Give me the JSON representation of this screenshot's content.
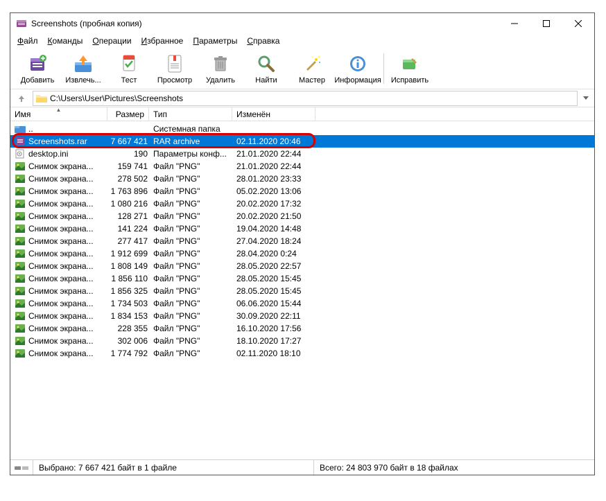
{
  "title": "Screenshots (пробная копия)",
  "menu": [
    "Файл",
    "Команды",
    "Операции",
    "Избранное",
    "Параметры",
    "Справка"
  ],
  "tools": [
    {
      "id": "add",
      "label": "Добавить"
    },
    {
      "id": "extract",
      "label": "Извлечь..."
    },
    {
      "id": "test",
      "label": "Тест"
    },
    {
      "id": "view",
      "label": "Просмотр"
    },
    {
      "id": "delete",
      "label": "Удалить"
    },
    {
      "id": "find",
      "label": "Найти"
    },
    {
      "id": "wizard",
      "label": "Мастер"
    },
    {
      "id": "info",
      "label": "Информация"
    },
    {
      "id": "sep"
    },
    {
      "id": "repair",
      "label": "Исправить"
    }
  ],
  "path": "C:\\Users\\User\\Pictures\\Screenshots",
  "columns": {
    "name": "Имя",
    "size": "Размер",
    "type": "Тип",
    "mod": "Изменён"
  },
  "rows": [
    {
      "icon": "up",
      "name": "..",
      "size": "",
      "type": "Системная папка",
      "mod": "",
      "sel": false
    },
    {
      "icon": "rar",
      "name": "Screenshots.rar",
      "size": "7 667 421",
      "type": "RAR archive",
      "mod": "02.11.2020 20:46",
      "sel": true,
      "hl": true
    },
    {
      "icon": "ini",
      "name": "desktop.ini",
      "size": "190",
      "type": "Параметры конф...",
      "mod": "21.01.2020 22:44",
      "sel": false
    },
    {
      "icon": "png",
      "name": "Снимок экрана...",
      "size": "159 741",
      "type": "Файл \"PNG\"",
      "mod": "21.01.2020 22:44",
      "sel": false
    },
    {
      "icon": "png",
      "name": "Снимок экрана...",
      "size": "278 502",
      "type": "Файл \"PNG\"",
      "mod": "28.01.2020 23:33",
      "sel": false
    },
    {
      "icon": "png",
      "name": "Снимок экрана...",
      "size": "1 763 896",
      "type": "Файл \"PNG\"",
      "mod": "05.02.2020 13:06",
      "sel": false
    },
    {
      "icon": "png",
      "name": "Снимок экрана...",
      "size": "1 080 216",
      "type": "Файл \"PNG\"",
      "mod": "20.02.2020 17:32",
      "sel": false
    },
    {
      "icon": "png",
      "name": "Снимок экрана...",
      "size": "128 271",
      "type": "Файл \"PNG\"",
      "mod": "20.02.2020 21:50",
      "sel": false
    },
    {
      "icon": "png",
      "name": "Снимок экрана...",
      "size": "141 224",
      "type": "Файл \"PNG\"",
      "mod": "19.04.2020 14:48",
      "sel": false
    },
    {
      "icon": "png",
      "name": "Снимок экрана...",
      "size": "277 417",
      "type": "Файл \"PNG\"",
      "mod": "27.04.2020 18:24",
      "sel": false
    },
    {
      "icon": "png",
      "name": "Снимок экрана...",
      "size": "1 912 699",
      "type": "Файл \"PNG\"",
      "mod": "28.04.2020 0:24",
      "sel": false
    },
    {
      "icon": "png",
      "name": "Снимок экрана...",
      "size": "1 808 149",
      "type": "Файл \"PNG\"",
      "mod": "28.05.2020 22:57",
      "sel": false
    },
    {
      "icon": "png",
      "name": "Снимок экрана...",
      "size": "1 856 110",
      "type": "Файл \"PNG\"",
      "mod": "28.05.2020 15:45",
      "sel": false
    },
    {
      "icon": "png",
      "name": "Снимок экрана...",
      "size": "1 856 325",
      "type": "Файл \"PNG\"",
      "mod": "28.05.2020 15:45",
      "sel": false
    },
    {
      "icon": "png",
      "name": "Снимок экрана...",
      "size": "1 734 503",
      "type": "Файл \"PNG\"",
      "mod": "06.06.2020 15:44",
      "sel": false
    },
    {
      "icon": "png",
      "name": "Снимок экрана...",
      "size": "1 834 153",
      "type": "Файл \"PNG\"",
      "mod": "30.09.2020 22:11",
      "sel": false
    },
    {
      "icon": "png",
      "name": "Снимок экрана...",
      "size": "228 355",
      "type": "Файл \"PNG\"",
      "mod": "16.10.2020 17:56",
      "sel": false
    },
    {
      "icon": "png",
      "name": "Снимок экрана...",
      "size": "302 006",
      "type": "Файл \"PNG\"",
      "mod": "18.10.2020 17:27",
      "sel": false
    },
    {
      "icon": "png",
      "name": "Снимок экрана...",
      "size": "1 774 792",
      "type": "Файл \"PNG\"",
      "mod": "02.11.2020 18:10",
      "sel": false
    }
  ],
  "status": {
    "selected": "Выбрано: 7 667 421 байт в 1 файле",
    "total": "Всего: 24 803 970 байт в 18 файлах"
  }
}
